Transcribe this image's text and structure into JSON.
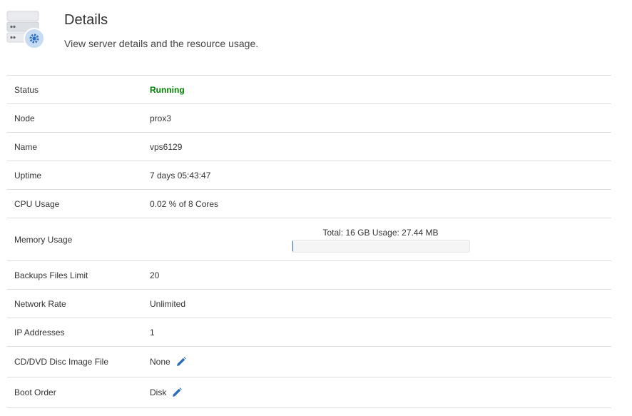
{
  "header": {
    "title": "Details",
    "subtitle": "View server details and the resource usage."
  },
  "icons": {
    "server": "server-gear-icon",
    "edit": "pencil-icon"
  },
  "colors": {
    "status_running": "#008000",
    "edit_icon": "#2a6db5"
  },
  "details": {
    "status": {
      "label": "Status",
      "value": "Running"
    },
    "node": {
      "label": "Node",
      "value": "prox3"
    },
    "name": {
      "label": "Name",
      "value": "vps6129"
    },
    "uptime": {
      "label": "Uptime",
      "value": "7 days 05:43:47"
    },
    "cpu": {
      "label": "CPU Usage",
      "value": "0.02 % of 8 Cores"
    },
    "memory": {
      "label": "Memory Usage",
      "value": "Total: 16 GB Usage: 27.44 MB",
      "usage_fraction": 0.0017
    },
    "backups": {
      "label": "Backups Files Limit",
      "value": "20"
    },
    "network": {
      "label": "Network Rate",
      "value": "Unlimited"
    },
    "ip": {
      "label": "IP Addresses",
      "value": "1"
    },
    "cdrom": {
      "label": "CD/DVD Disc Image File",
      "value": "None"
    },
    "boot": {
      "label": "Boot Order",
      "value": "Disk"
    }
  }
}
